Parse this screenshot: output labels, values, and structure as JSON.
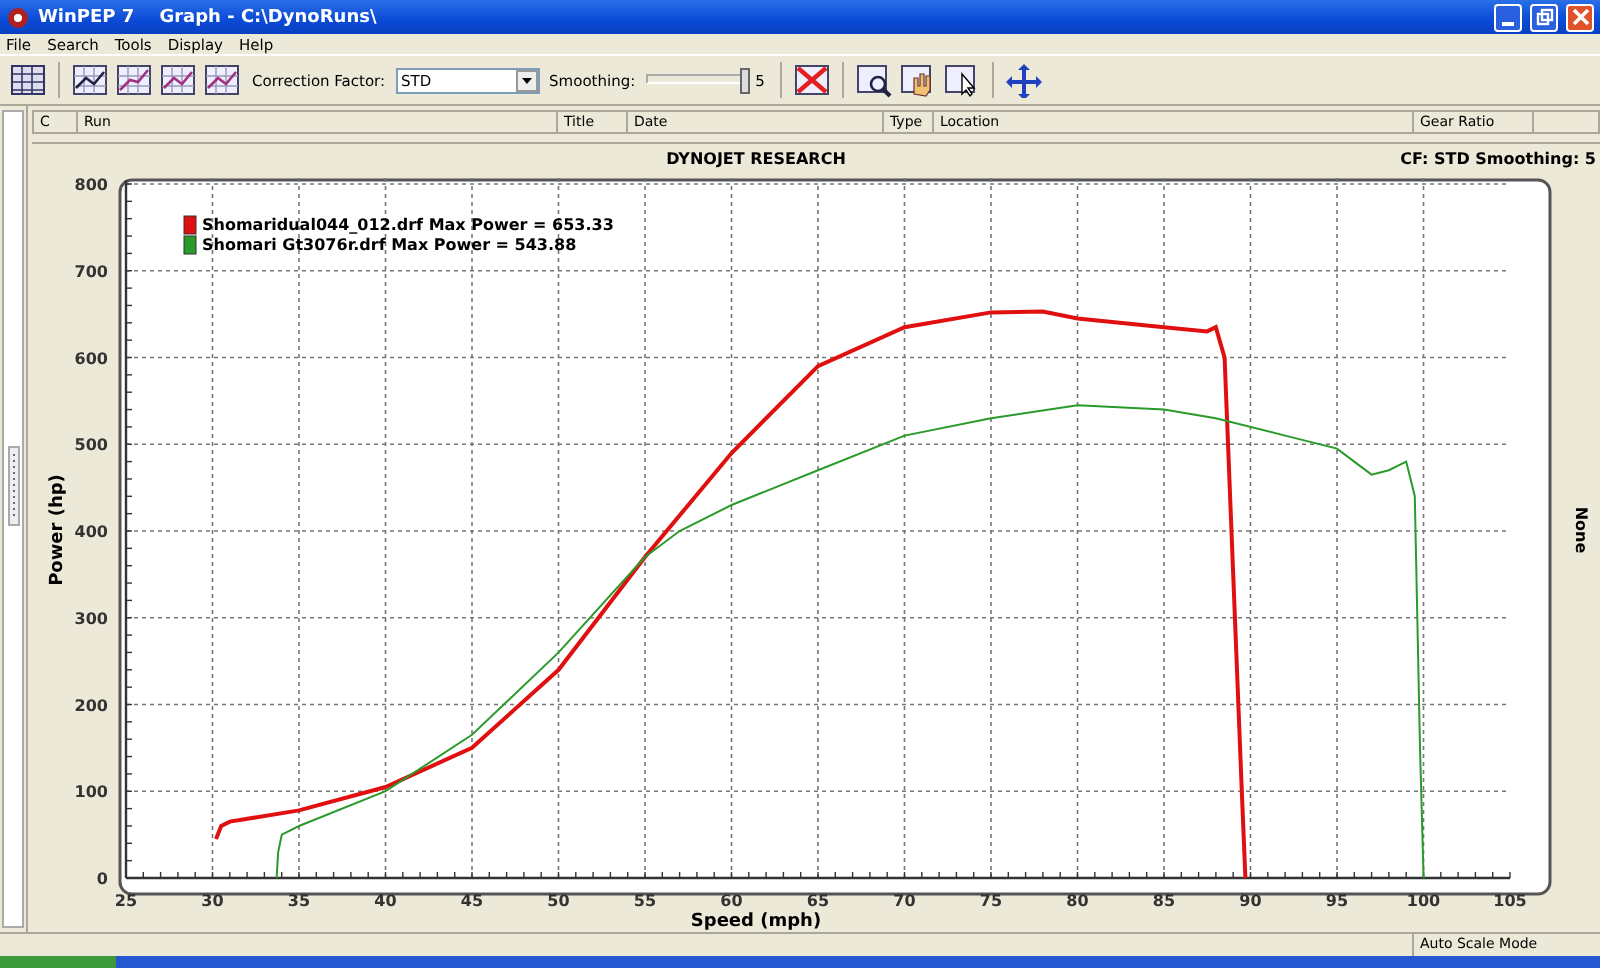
{
  "window": {
    "title": "WinPEP 7    Graph - C:\\DynoRuns\\"
  },
  "menu": [
    "File",
    "Search",
    "Tools",
    "Display",
    "Help"
  ],
  "toolbar": {
    "correction_label": "Correction Factor:",
    "correction_value": "STD",
    "smoothing_label": "Smoothing:",
    "smoothing": {
      "level": 1,
      "reading": "5"
    }
  },
  "table": {
    "columns": [
      "C",
      "Run",
      "Title",
      "Date",
      "Type",
      "Location",
      "Gear Ratio"
    ]
  },
  "chart_panel": {
    "title": "DYNOJET RESEARCH",
    "info": "CF: STD  Smoothing: 5",
    "right_label": "None",
    "chart_data": {
      "type": "line",
      "grid": true,
      "legend": true,
      "xlabel": "Speed (mph)",
      "ylabel": "Power (hp)",
      "xlim": [
        25,
        105
      ],
      "ylim": [
        0,
        800
      ],
      "xticks": [
        25,
        30,
        35,
        40,
        45,
        50,
        55,
        60,
        65,
        70,
        75,
        80,
        85,
        90,
        95,
        100,
        105
      ],
      "yticks": [
        0,
        100,
        200,
        300,
        400,
        500,
        600,
        700,
        800
      ],
      "series": [
        {
          "name": "Shomaridual044_012.drf Max Power = 653.33",
          "color": "#e01010",
          "x": [
            30.2,
            30.5,
            31,
            35,
            40,
            45,
            50,
            55,
            60,
            65,
            70,
            75,
            78,
            80,
            85,
            87.5,
            88,
            88.5,
            89,
            89.5,
            89.7
          ],
          "values": [
            45,
            60,
            65,
            78,
            105,
            150,
            240,
            370,
            490,
            590,
            635,
            652,
            653,
            645,
            635,
            630,
            635,
            600,
            350,
            100,
            0
          ]
        },
        {
          "name": "Shomari Gt3076r.drf Max Power = 543.88",
          "color": "#2a9a2a",
          "x": [
            33.7,
            33.8,
            34,
            35,
            40,
            45,
            50,
            55,
            57,
            60,
            65,
            70,
            75,
            80,
            85,
            88,
            92,
            95,
            96,
            97,
            98,
            99,
            99.5,
            99.8,
            100
          ],
          "values": [
            0,
            30,
            50,
            60,
            100,
            165,
            260,
            370,
            400,
            430,
            470,
            510,
            530,
            545,
            540,
            530,
            510,
            495,
            480,
            465,
            470,
            480,
            440,
            150,
            0
          ]
        }
      ]
    }
  },
  "status_bar": {
    "mode": "Auto Scale Mode"
  }
}
